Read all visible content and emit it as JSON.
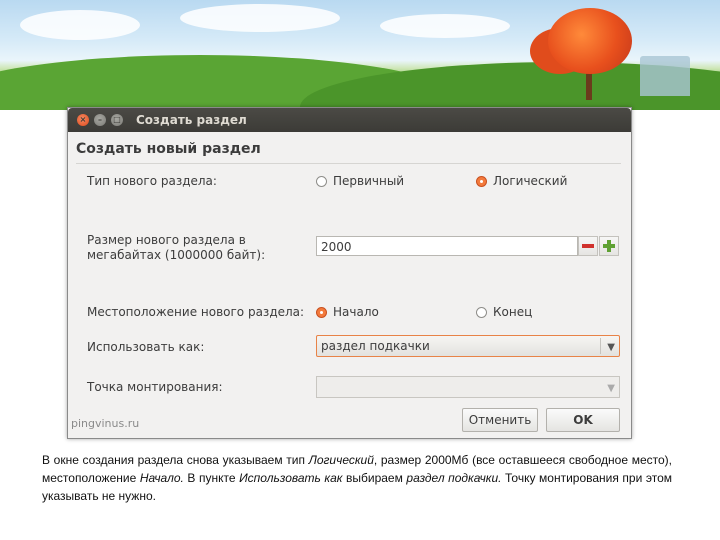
{
  "window": {
    "title": "Создать раздел",
    "heading": "Создать новый раздел"
  },
  "form": {
    "type_label": "Тип нового раздела:",
    "type_options": [
      {
        "label": "Первичный",
        "selected": false
      },
      {
        "label": "Логический",
        "selected": true
      }
    ],
    "size_label_line1": "Размер нового раздела в",
    "size_label_line2": "мегабайтах (1000000 байт):",
    "size_value": "2000",
    "location_label": "Местоположение нового раздела:",
    "location_options": [
      {
        "label": "Начало",
        "selected": true
      },
      {
        "label": "Конец",
        "selected": false
      }
    ],
    "use_as_label": "Использовать как:",
    "use_as_value": "раздел подкачки",
    "mount_label": "Точка монтирования:",
    "mount_value": ""
  },
  "buttons": {
    "cancel": "Отменить",
    "ok": "OK"
  },
  "watermark": "pingvinus.ru",
  "caption": {
    "p1": "В окне создания раздела снова указываем тип ",
    "i1": "Логический",
    "p2": ", размер 2000Мб (все оставшееся свободное место), местоположение ",
    "i2": "Начало.",
    "p3": " В пункте ",
    "i3": "Использовать как",
    "p4": " выбираем ",
    "i4": "раздел подкачки.",
    "p5": " Точку монтирования при этом указывать не нужно."
  },
  "colors": {
    "accent": "#f37a3c",
    "titlebar": "#3c3b37",
    "window_bg": "#f2f1f0"
  },
  "icons": [
    "close-icon",
    "minimize-icon",
    "maximize-icon",
    "minus-icon",
    "plus-icon",
    "dropdown-arrow-icon"
  ]
}
